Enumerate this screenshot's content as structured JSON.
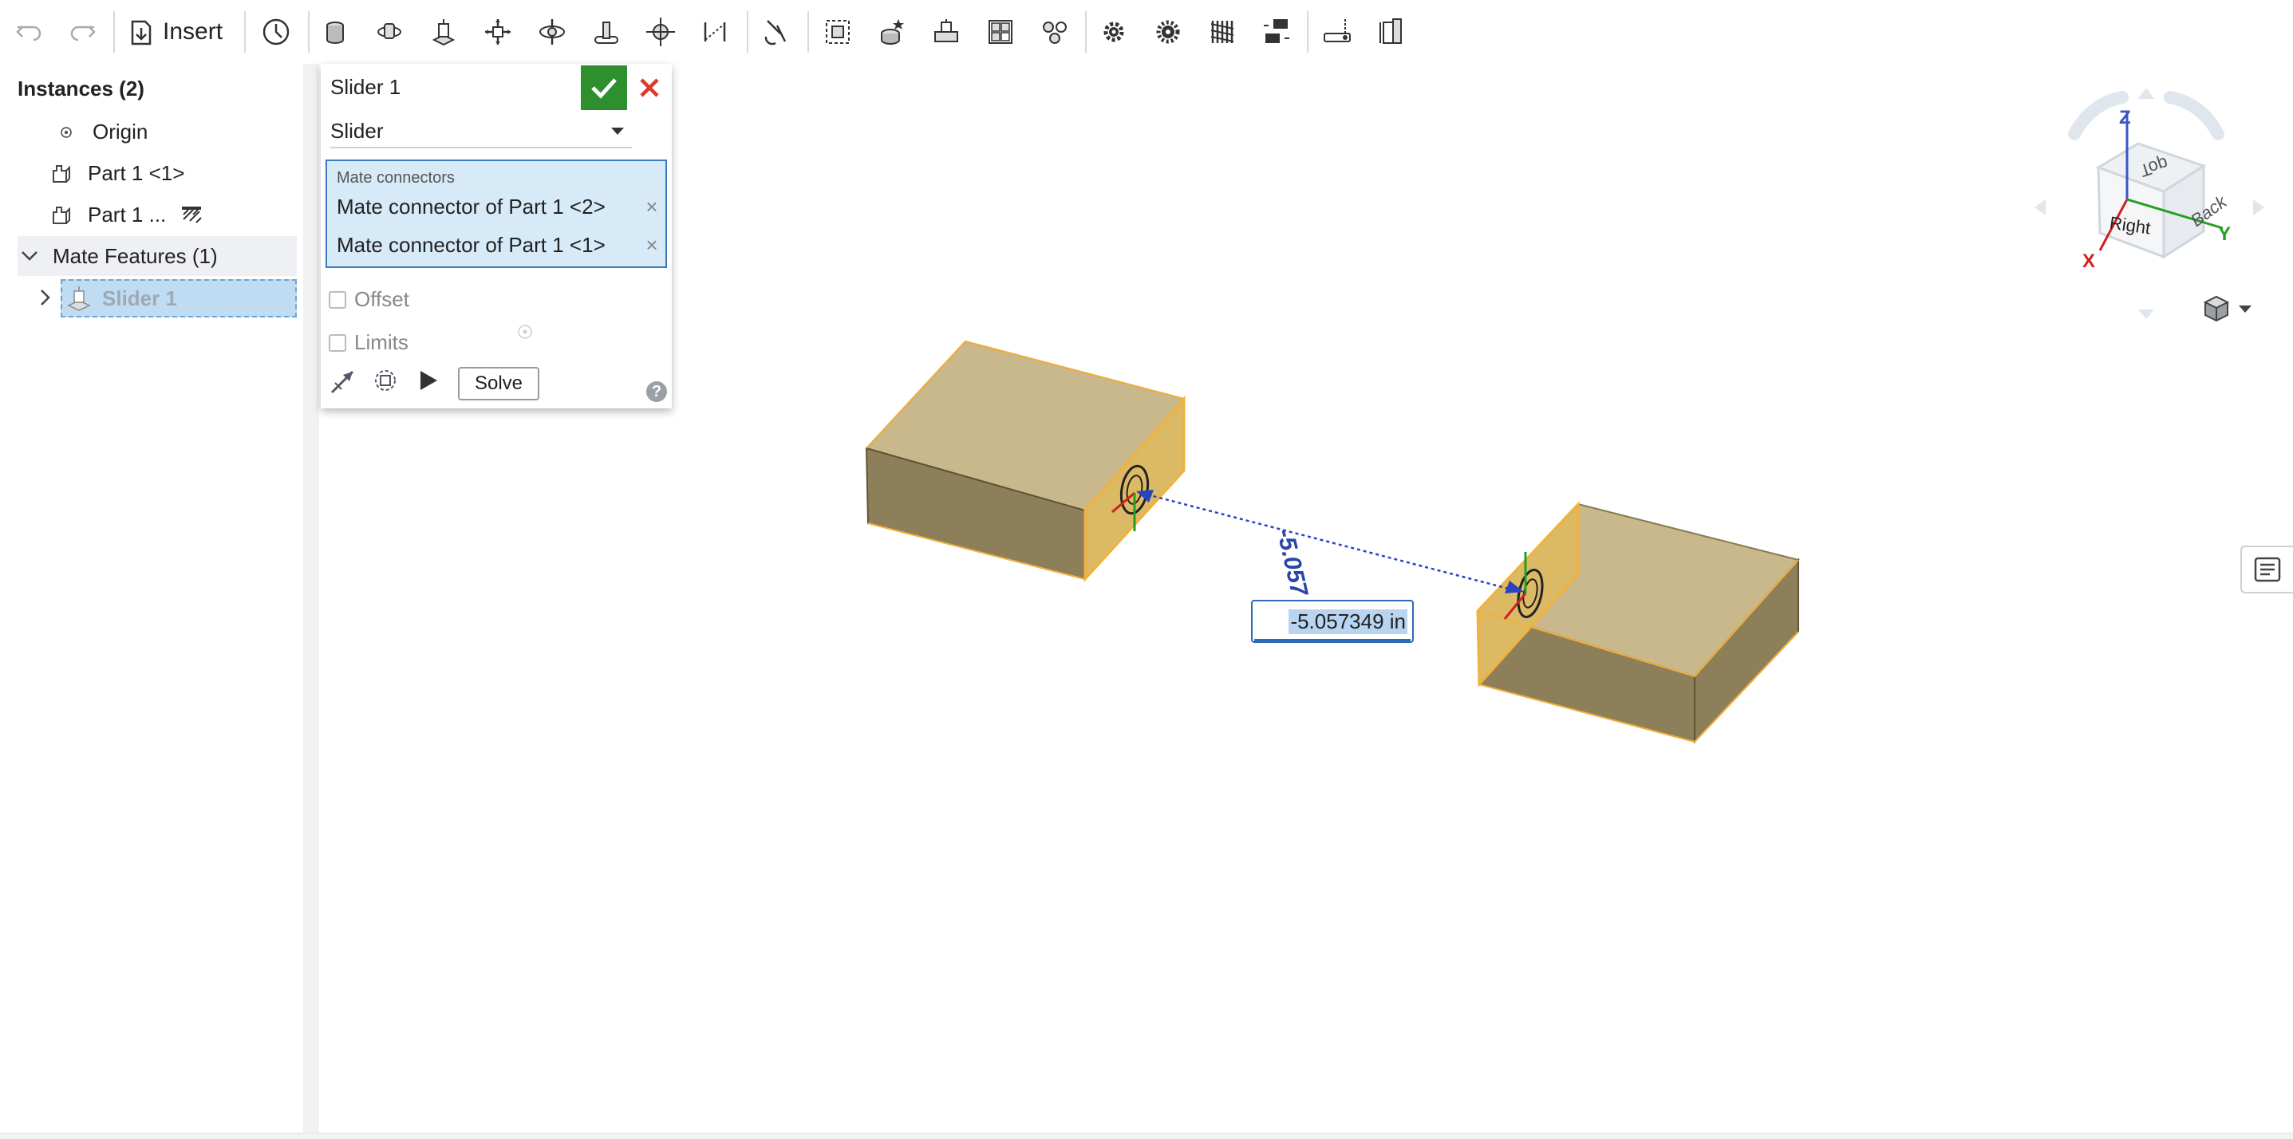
{
  "toolbar": {
    "insert_label": "Insert",
    "icons": [
      "undo-icon",
      "redo-icon",
      "insert-icon",
      "clock-history-icon",
      "fastened-mate-icon",
      "revolute-mate-icon",
      "slider-mate-icon",
      "planar-mate-icon",
      "cylindrical-mate-icon",
      "pin-slot-mate-icon",
      "ball-mate-icon",
      "parallel-mate-icon",
      "tangent-mate-icon",
      "mate-connector-icon",
      "group-icon",
      "replicate-icon",
      "linear-pattern-icon",
      "circular-pattern-icon",
      "mirror-icon",
      "gear-relation-icon",
      "rack-pinion-icon",
      "screw-relation-icon",
      "linear-relation-icon",
      "named-position-icon",
      "measure-icon",
      "section-view-icon"
    ]
  },
  "left_panel": {
    "instances_title": "Instances (2)",
    "origin_label": "Origin",
    "part1_label": "Part 1 <1>",
    "part2_label": "Part 1 ...",
    "mate_features_label": "Mate Features (1)",
    "slider_item_label": "Slider 1"
  },
  "dialog": {
    "title": "Slider 1",
    "type_value": "Slider",
    "mate_connectors_label": "Mate connectors",
    "mate_connectors": [
      "Mate connector of Part 1 <2>",
      "Mate connector of Part 1 <1>"
    ],
    "offset_label": "Offset",
    "limits_label": "Limits",
    "solve_label": "Solve",
    "help_label": "?"
  },
  "viewport": {
    "dimension_value": "-5.057349 in",
    "dimension_label": "-5.057"
  },
  "viewcube": {
    "top_label": "Top",
    "right_label": "Right",
    "back_label": "Back",
    "x_label": "X",
    "y_label": "Y",
    "z_label": "Z"
  },
  "colors": {
    "accent": "#2e8f2e",
    "cancel": "#d93a2b",
    "selection": "#bfdcf3",
    "part_face_top": "#c9b88c",
    "part_face_front": "#8c7f5a",
    "part_face_side": "#dcb964",
    "highlight_edge": "#f2b13a",
    "dimension": "#2a44a8"
  }
}
